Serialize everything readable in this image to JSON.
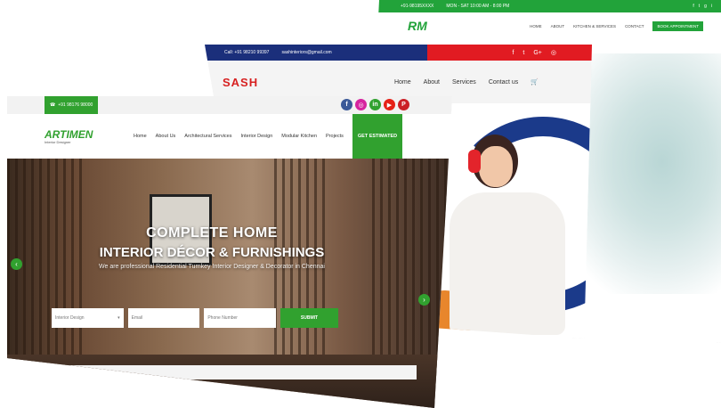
{
  "back_site": {
    "topbar": {
      "phone": "+91-98195XXXX",
      "email": "MON - SAT 10:00 AM - 8:00 PM",
      "social": [
        "f",
        "t",
        "g",
        "i"
      ]
    },
    "logo": "RM",
    "nav": [
      "HOME",
      "ABOUT",
      "KITCHEN & SERVICES",
      "CONTACT"
    ],
    "cta": "BOOK APPOINTMENT"
  },
  "mid_site": {
    "topbar": {
      "call": "Call: +91 98210 99397",
      "email": "sashinteriors@gmail.com",
      "social": [
        "f",
        "t",
        "G+",
        "◎"
      ]
    },
    "logo": "SASH",
    "nav": [
      "Home",
      "About",
      "Services",
      "Contact us"
    ]
  },
  "front_site": {
    "topbar": {
      "phone": "+91 98176 98000",
      "social": [
        "f",
        "◎",
        "in",
        "▶",
        "P"
      ]
    },
    "logo": {
      "mark": "ARTIMEN",
      "sub": "Interior Designer"
    },
    "nav": [
      "Home",
      "About Us",
      "Architectural Services",
      "Interior Design",
      "Modular Kitchen",
      "Projects"
    ],
    "cta": "GET ESTIMATED",
    "hero": {
      "line1": "COMPLETE HOME",
      "line2": "INTERIOR DÉCOR & FURNISHINGS",
      "tagline": "We are professional Residential Turnkey Interior Designer & Decorator in Chennai"
    },
    "form": {
      "select": "Interior Design",
      "email": "Email",
      "phone": "Phone Number",
      "submit": "SUBMIT"
    },
    "arrows": {
      "left": "‹",
      "right": "›"
    }
  },
  "colors": {
    "green": "#31a12f",
    "sash_blue": "#1b2f7b",
    "sash_red": "#e11b22"
  }
}
